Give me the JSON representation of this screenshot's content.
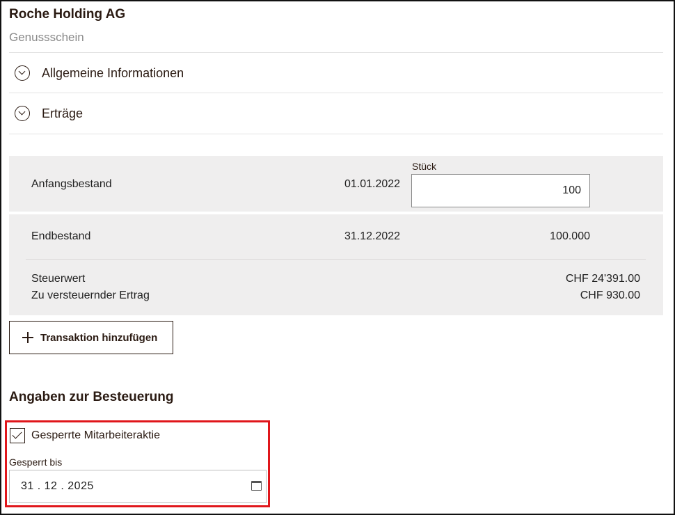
{
  "header": {
    "title": "Roche Holding AG",
    "subtitle": "Genussschein"
  },
  "sections": [
    {
      "label": "Allgemeine Informationen"
    },
    {
      "label": "Erträge"
    }
  ],
  "holdings": {
    "start": {
      "label": "Anfangsbestand",
      "date": "01.01.2022",
      "quantity_label": "Stück",
      "quantity": "100"
    },
    "end": {
      "label": "Endbestand",
      "date": "31.12.2022",
      "quantity": "100.000"
    },
    "tax_value": {
      "label": "Steuerwert",
      "value": "CHF 24'391.00"
    },
    "taxable_income": {
      "label": "Zu versteuernder Ertrag",
      "value": "CHF 930.00"
    }
  },
  "actions": {
    "add_transaction": "Transaktion hinzufügen"
  },
  "taxation": {
    "heading": "Angaben zur Besteuerung",
    "locked_employee_share": {
      "label": "Gesperrte Mitarbeiteraktie",
      "checked": true
    },
    "locked_until": {
      "label": "Gesperrt bis",
      "value": "31 . 12 . 2025"
    }
  },
  "colors": {
    "highlight": "#e0161b",
    "panel": "#efeeee",
    "text": "#2a1a12"
  }
}
